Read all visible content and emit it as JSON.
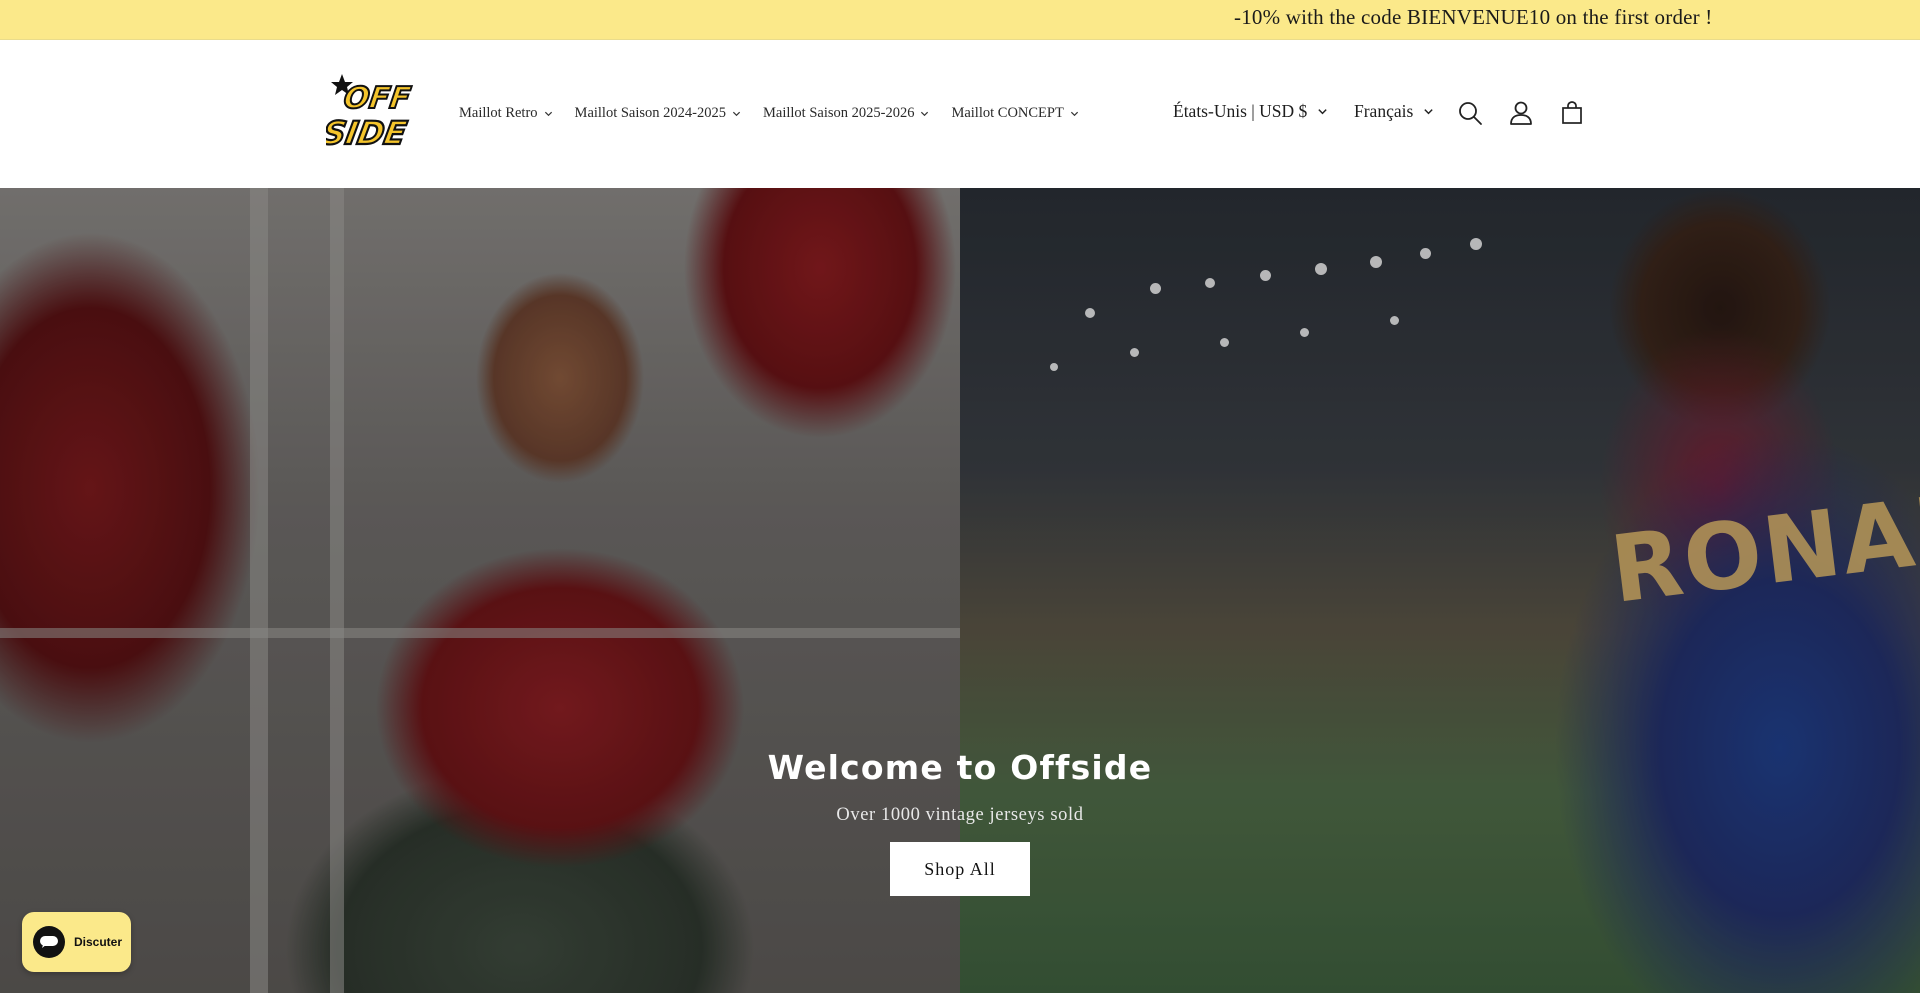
{
  "announcement": {
    "text": "-10% with the code BIENVENUE10 on the first order !"
  },
  "header": {
    "logo_text_top": "OFF",
    "logo_text_bottom": "SIDE",
    "nav": [
      {
        "label": "Maillot Retro"
      },
      {
        "label": "Maillot Saison 2024-2025"
      },
      {
        "label": "Maillot Saison 2025-2026"
      },
      {
        "label": "Maillot CONCEPT"
      }
    ],
    "currency": "États-Unis | USD $",
    "language": "Français",
    "icons": {
      "search": "search-icon",
      "account": "account-icon",
      "cart": "cart-icon"
    }
  },
  "hero": {
    "title": "Welcome to Offside",
    "subtitle": "Over 1000 vintage jerseys sold",
    "button_label": "Shop All",
    "jersey_text": "RONALDI"
  },
  "chat": {
    "label": "Discuter"
  },
  "colors": {
    "announcement_bg": "#fbe98a",
    "logo_yellow": "#f4c42b"
  }
}
